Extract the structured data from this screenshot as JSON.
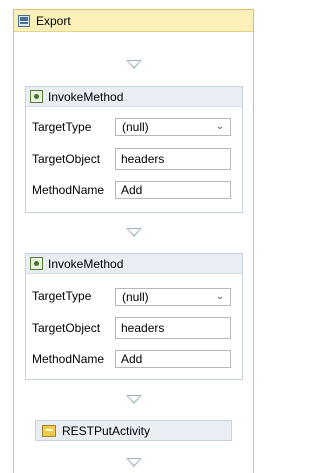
{
  "sequence": {
    "title": "Export"
  },
  "activities": [
    {
      "title": "InvokeMethod",
      "fields": {
        "target_type_label": "TargetType",
        "target_type_value": "(null)",
        "target_object_label": "TargetObject",
        "target_object_value": "headers",
        "method_name_label": "MethodName",
        "method_name_value": "Add"
      }
    },
    {
      "title": "InvokeMethod",
      "fields": {
        "target_type_label": "TargetType",
        "target_type_value": "(null)",
        "target_object_label": "TargetObject",
        "target_object_value": "headers",
        "method_name_label": "MethodName",
        "method_name_value": "Add"
      }
    }
  ],
  "rest_activity": {
    "title": "RESTPutActivity"
  },
  "icons": {
    "sequence": "sequence-icon",
    "invoke": "invoke-method-icon",
    "rest": "rest-activity-icon",
    "drop": "drop-target-icon",
    "dropdown": "chevron-down-icon"
  },
  "colors": {
    "sequence_header": "#fbf0b8",
    "sequence_border": "#d9c06a",
    "activity_header": "#e9eef4",
    "drop_arrow": "#9fb4c8"
  }
}
